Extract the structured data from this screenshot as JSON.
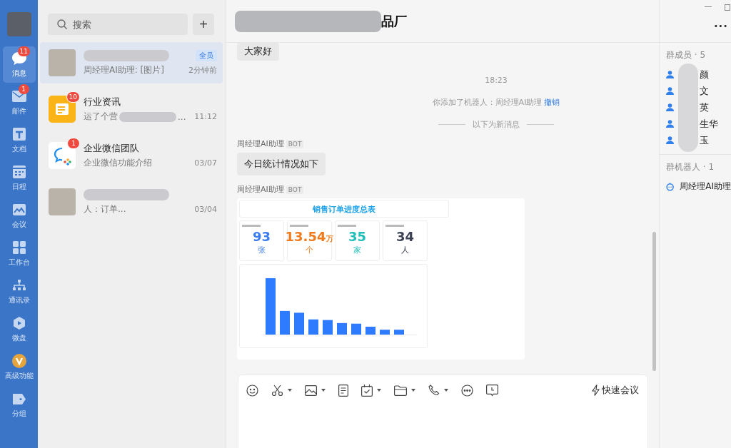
{
  "rail": {
    "items": [
      {
        "kind": "chat",
        "label": "消息",
        "badge": "11",
        "selected": true
      },
      {
        "kind": "mail",
        "label": "邮件",
        "badge": "1",
        "selected": false
      },
      {
        "kind": "doc",
        "label": "文档",
        "selected": false
      },
      {
        "kind": "calendar",
        "label": "日程",
        "selected": false
      },
      {
        "kind": "meeting",
        "label": "会议",
        "selected": false
      },
      {
        "kind": "grid",
        "label": "工作台",
        "selected": false
      },
      {
        "kind": "org",
        "label": "通讯录",
        "selected": false
      },
      {
        "kind": "drive",
        "label": "微盘",
        "selected": false
      },
      {
        "kind": "premium",
        "label": "高级功能",
        "selected": false
      },
      {
        "kind": "tag",
        "label": "分组",
        "selected": false
      }
    ]
  },
  "chat_list": {
    "search": {
      "placeholder": "搜索"
    },
    "add_button": "+",
    "chats": [
      {
        "kind": "group",
        "preview": "周经理AI助理: [图片]",
        "tag": "全员",
        "time": "2分钟前",
        "selected": true
      },
      {
        "kind": "news",
        "name": "行业资讯",
        "badge": "10",
        "preview": "运了个营",
        "preview_end": "...",
        "time": "11:12",
        "selected": false
      },
      {
        "kind": "wecom",
        "name": "企业微信团队",
        "badge": "1",
        "preview": "企业微信功能介绍",
        "time": "03/07",
        "selected": false
      },
      {
        "kind": "group",
        "preview": "人：订单...",
        "time": "03/04",
        "selected": false
      }
    ]
  },
  "header": {
    "title": "品厂",
    "more": "···"
  },
  "messages": [
    {
      "kind": "text",
      "text": "大家好"
    },
    {
      "kind": "time",
      "text": "18:23"
    },
    {
      "kind": "system",
      "text": "你添加了机器人：周经理AI助理",
      "link": "撤销"
    },
    {
      "kind": "divider",
      "text": "以下为新消息"
    },
    {
      "kind": "bot_text",
      "sender": "周经理AI助理",
      "badge": "BOT",
      "text": "今日统计情况如下"
    },
    {
      "kind": "bot_report",
      "sender": "周经理AI助理",
      "badge": "BOT",
      "report": {
        "title": "销售订单进度总表",
        "kpis": [
          {
            "value": "93",
            "unit": "张",
            "color": "#3b7cf0"
          },
          {
            "value": "13.54",
            "suffix": "万",
            "unit": "个",
            "color": "#f07a1c"
          },
          {
            "value": "35",
            "unit": "家",
            "color": "#1dbfb8"
          },
          {
            "value": "34",
            "unit": "人",
            "color": "#3b4254"
          }
        ]
      }
    }
  ],
  "members": {
    "title": "群成员 · 5",
    "items": [
      {
        "name": "颜"
      },
      {
        "name": "文"
      },
      {
        "name": "英"
      },
      {
        "name": "生华"
      },
      {
        "name": "玉"
      }
    ]
  },
  "robots": {
    "title": "群机器人 · 1",
    "items": [
      {
        "name": "周经理AI助理"
      }
    ]
  },
  "composer": {
    "tools": [
      {
        "kind": "emoji",
        "caret": false
      },
      {
        "kind": "scissors",
        "caret": true
      },
      {
        "kind": "image",
        "caret": true
      },
      {
        "kind": "doc",
        "caret": false
      },
      {
        "kind": "calendar",
        "caret": true
      },
      {
        "kind": "folder",
        "caret": true
      },
      {
        "kind": "phone",
        "caret": true
      },
      {
        "kind": "more",
        "caret": false
      },
      {
        "kind": "clock",
        "caret": false
      }
    ],
    "quick_meeting": "快速会议"
  }
}
